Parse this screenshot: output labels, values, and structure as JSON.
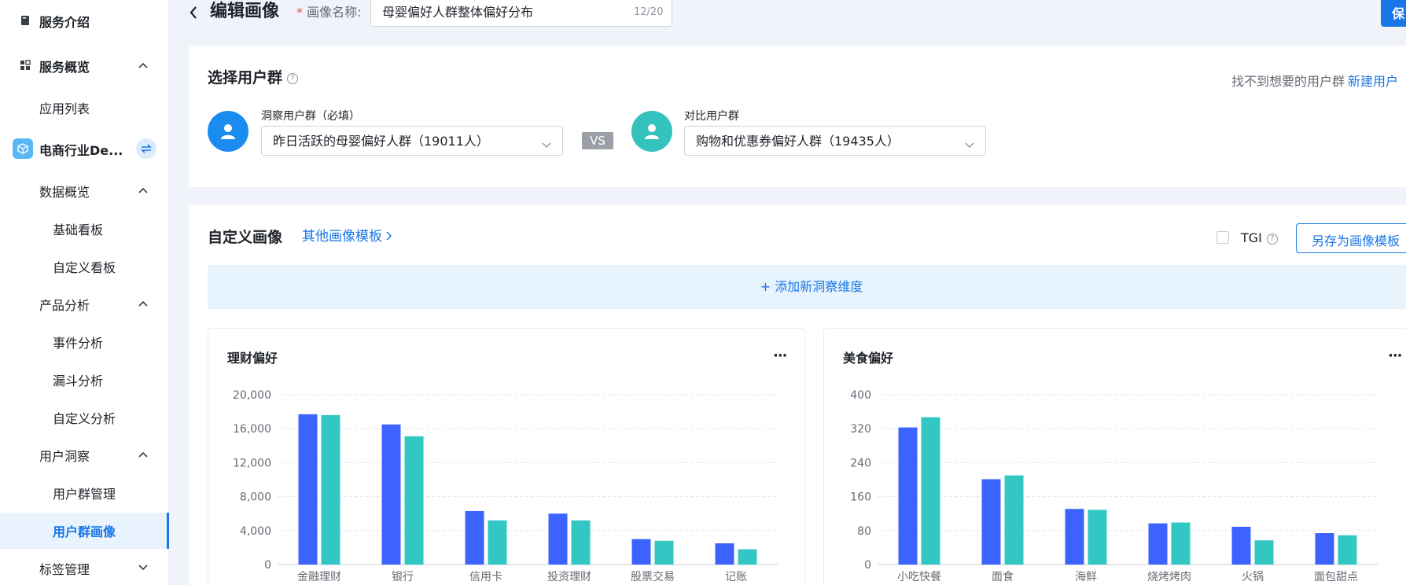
{
  "sidebar": {
    "items": [
      {
        "label": "服务介绍"
      },
      {
        "label": "服务概览"
      },
      {
        "label": "应用列表"
      },
      {
        "label": "电商行业De..."
      },
      {
        "label": "数据概览"
      },
      {
        "label": "基础看板"
      },
      {
        "label": "自定义看板"
      },
      {
        "label": "产品分析"
      },
      {
        "label": "事件分析"
      },
      {
        "label": "漏斗分析"
      },
      {
        "label": "自定义分析"
      },
      {
        "label": "用户洞察"
      },
      {
        "label": "用户群管理"
      },
      {
        "label": "用户群画像"
      },
      {
        "label": "标签管理"
      }
    ]
  },
  "header": {
    "title": "编辑画像",
    "required_mark": "*",
    "name_label": "画像名称:",
    "name_value": "母婴偏好人群整体偏好分布",
    "name_count": "12/20",
    "save_label": "保"
  },
  "select_group": {
    "title": "选择用户群",
    "help": "?",
    "cant_find": "找不到想要的用户群",
    "new_link": "新建用户",
    "insight_label": "洞察用户群（必填）",
    "insight_value": "昨日活跃的母婴偏好人群（19011人）",
    "vs": "VS",
    "compare_label": "对比用户群",
    "compare_value": "购物和优惠券偏好人群（19435人）"
  },
  "custom": {
    "title": "自定义画像",
    "other_templates": "其他画像模板",
    "tgi_label": "TGI",
    "help": "?",
    "save_template": "另存为画像模板",
    "add_dimension": "+ 添加新洞察维度"
  },
  "colors": {
    "series_a": "#3d63ff",
    "series_b": "#33c7c4",
    "accent": "#1776e8"
  },
  "chart_data": [
    {
      "type": "bar",
      "title": "理财偏好",
      "more": "···",
      "categories": [
        "金融理财",
        "银行",
        "信用卡",
        "投资理财",
        "股票交易",
        "记账"
      ],
      "series": [
        {
          "values": [
            17700,
            16500,
            6300,
            6000,
            3000,
            2500
          ]
        },
        {
          "values": [
            17600,
            15100,
            5200,
            5200,
            2800,
            1800
          ]
        }
      ],
      "yticks": [
        "0",
        "4,000",
        "8,000",
        "12,000",
        "16,000",
        "20,000"
      ],
      "ylim": [
        0,
        20000
      ]
    },
    {
      "type": "bar",
      "title": "美食偏好",
      "more": "···",
      "categories": [
        "小吃快餐",
        "面食",
        "海鲜",
        "烧烤烤肉",
        "火锅",
        "面包甜点"
      ],
      "series": [
        {
          "values": [
            323,
            201,
            131,
            97,
            89,
            74
          ]
        },
        {
          "values": [
            347,
            210,
            129,
            99,
            57,
            69
          ]
        }
      ],
      "yticks": [
        "0",
        "80",
        "160",
        "240",
        "320",
        "400"
      ],
      "ylim": [
        0,
        400
      ]
    }
  ]
}
